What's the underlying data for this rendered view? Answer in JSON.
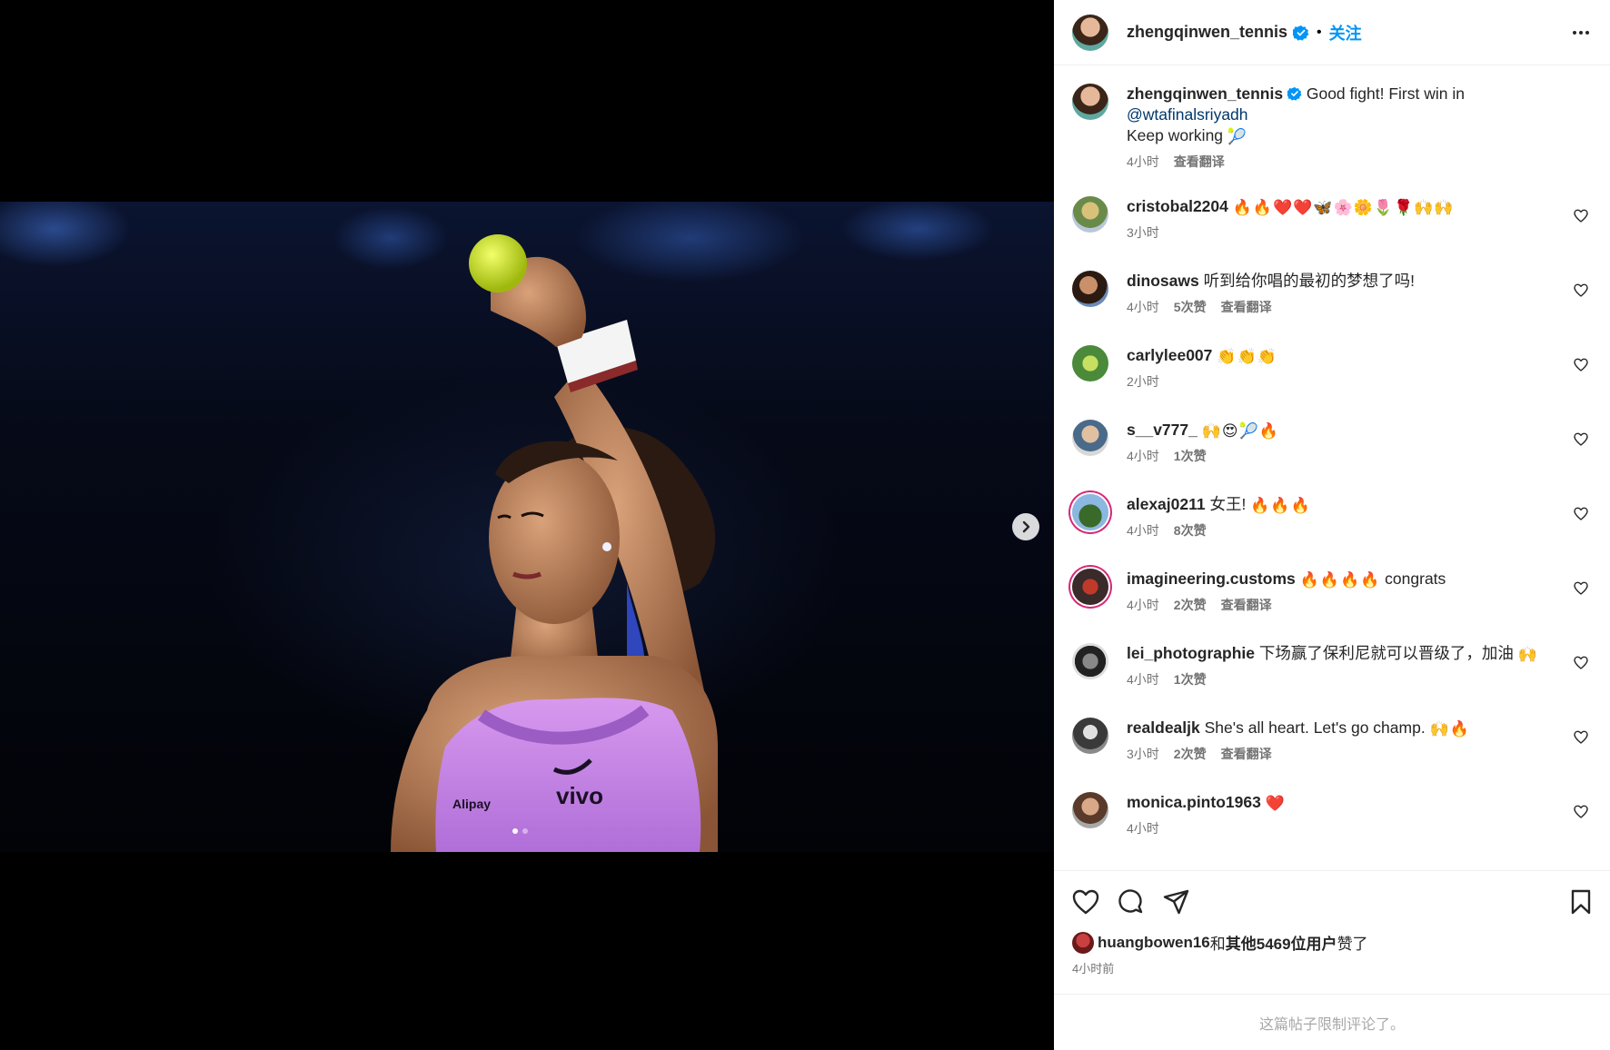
{
  "header": {
    "username": "zhengqinwen_tennis",
    "separator": "•",
    "follow_label": "关注"
  },
  "caption": {
    "username": "zhengqinwen_tennis",
    "text_line1": "Good fight! First win in",
    "mention": "@wtafinalsriyadh",
    "text_line2": "Keep working",
    "emoji": "🎾",
    "time": "4小时",
    "translate": "查看翻译"
  },
  "photo": {
    "sponsor_left": "Alipay",
    "sponsor_right": "vivo"
  },
  "comments": [
    {
      "username": "cristobal2204",
      "text": "",
      "emoji": "🔥🔥❤️❤️🦋🌸🌼🌷🌹🙌🙌",
      "time": "3小时",
      "likes": "",
      "translate": ""
    },
    {
      "username": "dinosaws",
      "text": "听到给你唱的最初的梦想了吗!",
      "emoji": "",
      "time": "4小时",
      "likes": "5次赞",
      "translate": "查看翻译"
    },
    {
      "username": "carlylee007",
      "text": "",
      "emoji": "👏👏👏",
      "time": "2小时",
      "likes": "",
      "translate": ""
    },
    {
      "username": "s__v777_",
      "text": "",
      "emoji": "🙌😍🎾🔥",
      "time": "4小时",
      "likes": "1次赞",
      "translate": ""
    },
    {
      "username": "alexaj0211",
      "text": "女王!",
      "emoji": "🔥🔥🔥",
      "time": "4小时",
      "likes": "8次赞",
      "translate": ""
    },
    {
      "username": "imagineering.customs",
      "text": "",
      "emoji": "🔥🔥🔥🔥",
      "text_after": "congrats",
      "time": "4小时",
      "likes": "2次赞",
      "translate": "查看翻译"
    },
    {
      "username": "lei_photographie",
      "text": "下场赢了保利尼就可以晋级了，加油",
      "emoji": "🙌",
      "time": "4小时",
      "likes": "1次赞",
      "translate": ""
    },
    {
      "username": "realdealjk",
      "text": "She's all heart. Let's go champ.",
      "emoji": "🙌🔥",
      "time": "3小时",
      "likes": "2次赞",
      "translate": "查看翻译"
    },
    {
      "username": "monica.pinto1963",
      "text": "",
      "emoji": "❤️",
      "time": "4小时",
      "likes": "",
      "translate": ""
    }
  ],
  "likes_line": {
    "user": "huangbowen16",
    "connector": "和",
    "others": "其他5469位用户",
    "suffix": "赞了"
  },
  "post_time": "4小时前",
  "restricted_notice": "这篇帖子限制评论了。",
  "colors": {
    "accent": "#0095f6",
    "verified": "#0095f6",
    "mention": "#00376b",
    "top_color": "#c98be6"
  }
}
